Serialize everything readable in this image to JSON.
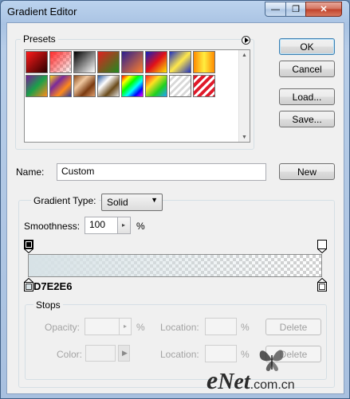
{
  "window": {
    "title": "Gradient Editor",
    "minimize_label": "—",
    "maximize_label": "❐",
    "close_label": "✕"
  },
  "presets": {
    "label": "Presets",
    "menu_icon": "arrow-circle-icon",
    "swatches": [
      {
        "name": "red-black",
        "css": "linear-gradient(135deg,#ff1a1a,#2a0000)"
      },
      {
        "name": "red-transparent",
        "css": "linear-gradient(135deg,#ff2a2a,rgba(255,255,255,0))"
      },
      {
        "name": "black-white",
        "css": "linear-gradient(135deg,#000,#fff)"
      },
      {
        "name": "red-green",
        "css": "linear-gradient(135deg,#e02020,#1f8a1f)"
      },
      {
        "name": "violet-orange",
        "css": "linear-gradient(135deg,#2b1f8f,#ff7f2a)"
      },
      {
        "name": "blue-red-yellow",
        "css": "linear-gradient(135deg,#1020c0,#e0101a,#ffe600)"
      },
      {
        "name": "blue-yellow-blue",
        "css": "linear-gradient(135deg,#2030c0,#ffe84a,#2030c0)"
      },
      {
        "name": "orange-yellow-orange",
        "css": "linear-gradient(90deg,#ff8a00,#ffee40,#ff8a00)"
      },
      {
        "name": "violet-green-orange",
        "css": "linear-gradient(135deg,#7a1a9a,#1aa04a,#ff8a1a)"
      },
      {
        "name": "yellow-violet-orange-blue",
        "css": "linear-gradient(135deg,#ffd21a,#7a2a9a,#ff8a1a,#2a3aa0)"
      },
      {
        "name": "copper",
        "css": "linear-gradient(135deg,#8a4a1a,#f0c8a0,#7a3a10,#e0a070)"
      },
      {
        "name": "chrome",
        "css": "linear-gradient(135deg,#2a5aa0,#ffffff,#6a4a1a,#e0e0e0)"
      },
      {
        "name": "spectrum",
        "css": "linear-gradient(135deg,#ff0000,#ffff00,#00ff00,#00ffff,#0000ff,#ff00ff)"
      },
      {
        "name": "transparent-rainbow",
        "css": "linear-gradient(135deg,#ff2020,#ffe020,#20d020,#20a0ff)"
      },
      {
        "name": "transparent-stripes",
        "css": "repeating-linear-gradient(135deg,#ffffff 0 3px,#d8d8d8 3px 6px)"
      },
      {
        "name": "red-stripes",
        "css": "repeating-linear-gradient(135deg,#e01a2a 0 4px,#ffffff 4px 7px)"
      }
    ]
  },
  "buttons": {
    "ok": "OK",
    "cancel": "Cancel",
    "load": "Load...",
    "save": "Save...",
    "new": "New"
  },
  "name_field": {
    "label": "Name:",
    "value": "Custom"
  },
  "gradient": {
    "type_label": "Gradient Type:",
    "type_value": "Solid",
    "smoothness_label": "Smoothness:",
    "smoothness_value": "100",
    "smoothness_unit": "%",
    "start_color": "#D7E2E6",
    "color_readout": "D7E2E6"
  },
  "stops": {
    "label": "Stops",
    "opacity_label": "Opacity:",
    "opacity_unit": "%",
    "location_label": "Location:",
    "location_unit": "%",
    "delete_label": "Delete",
    "color_label": "Color:"
  },
  "watermark": {
    "text_e": "e",
    "text_rest": "Net",
    "text_domain": ".com.cn"
  }
}
